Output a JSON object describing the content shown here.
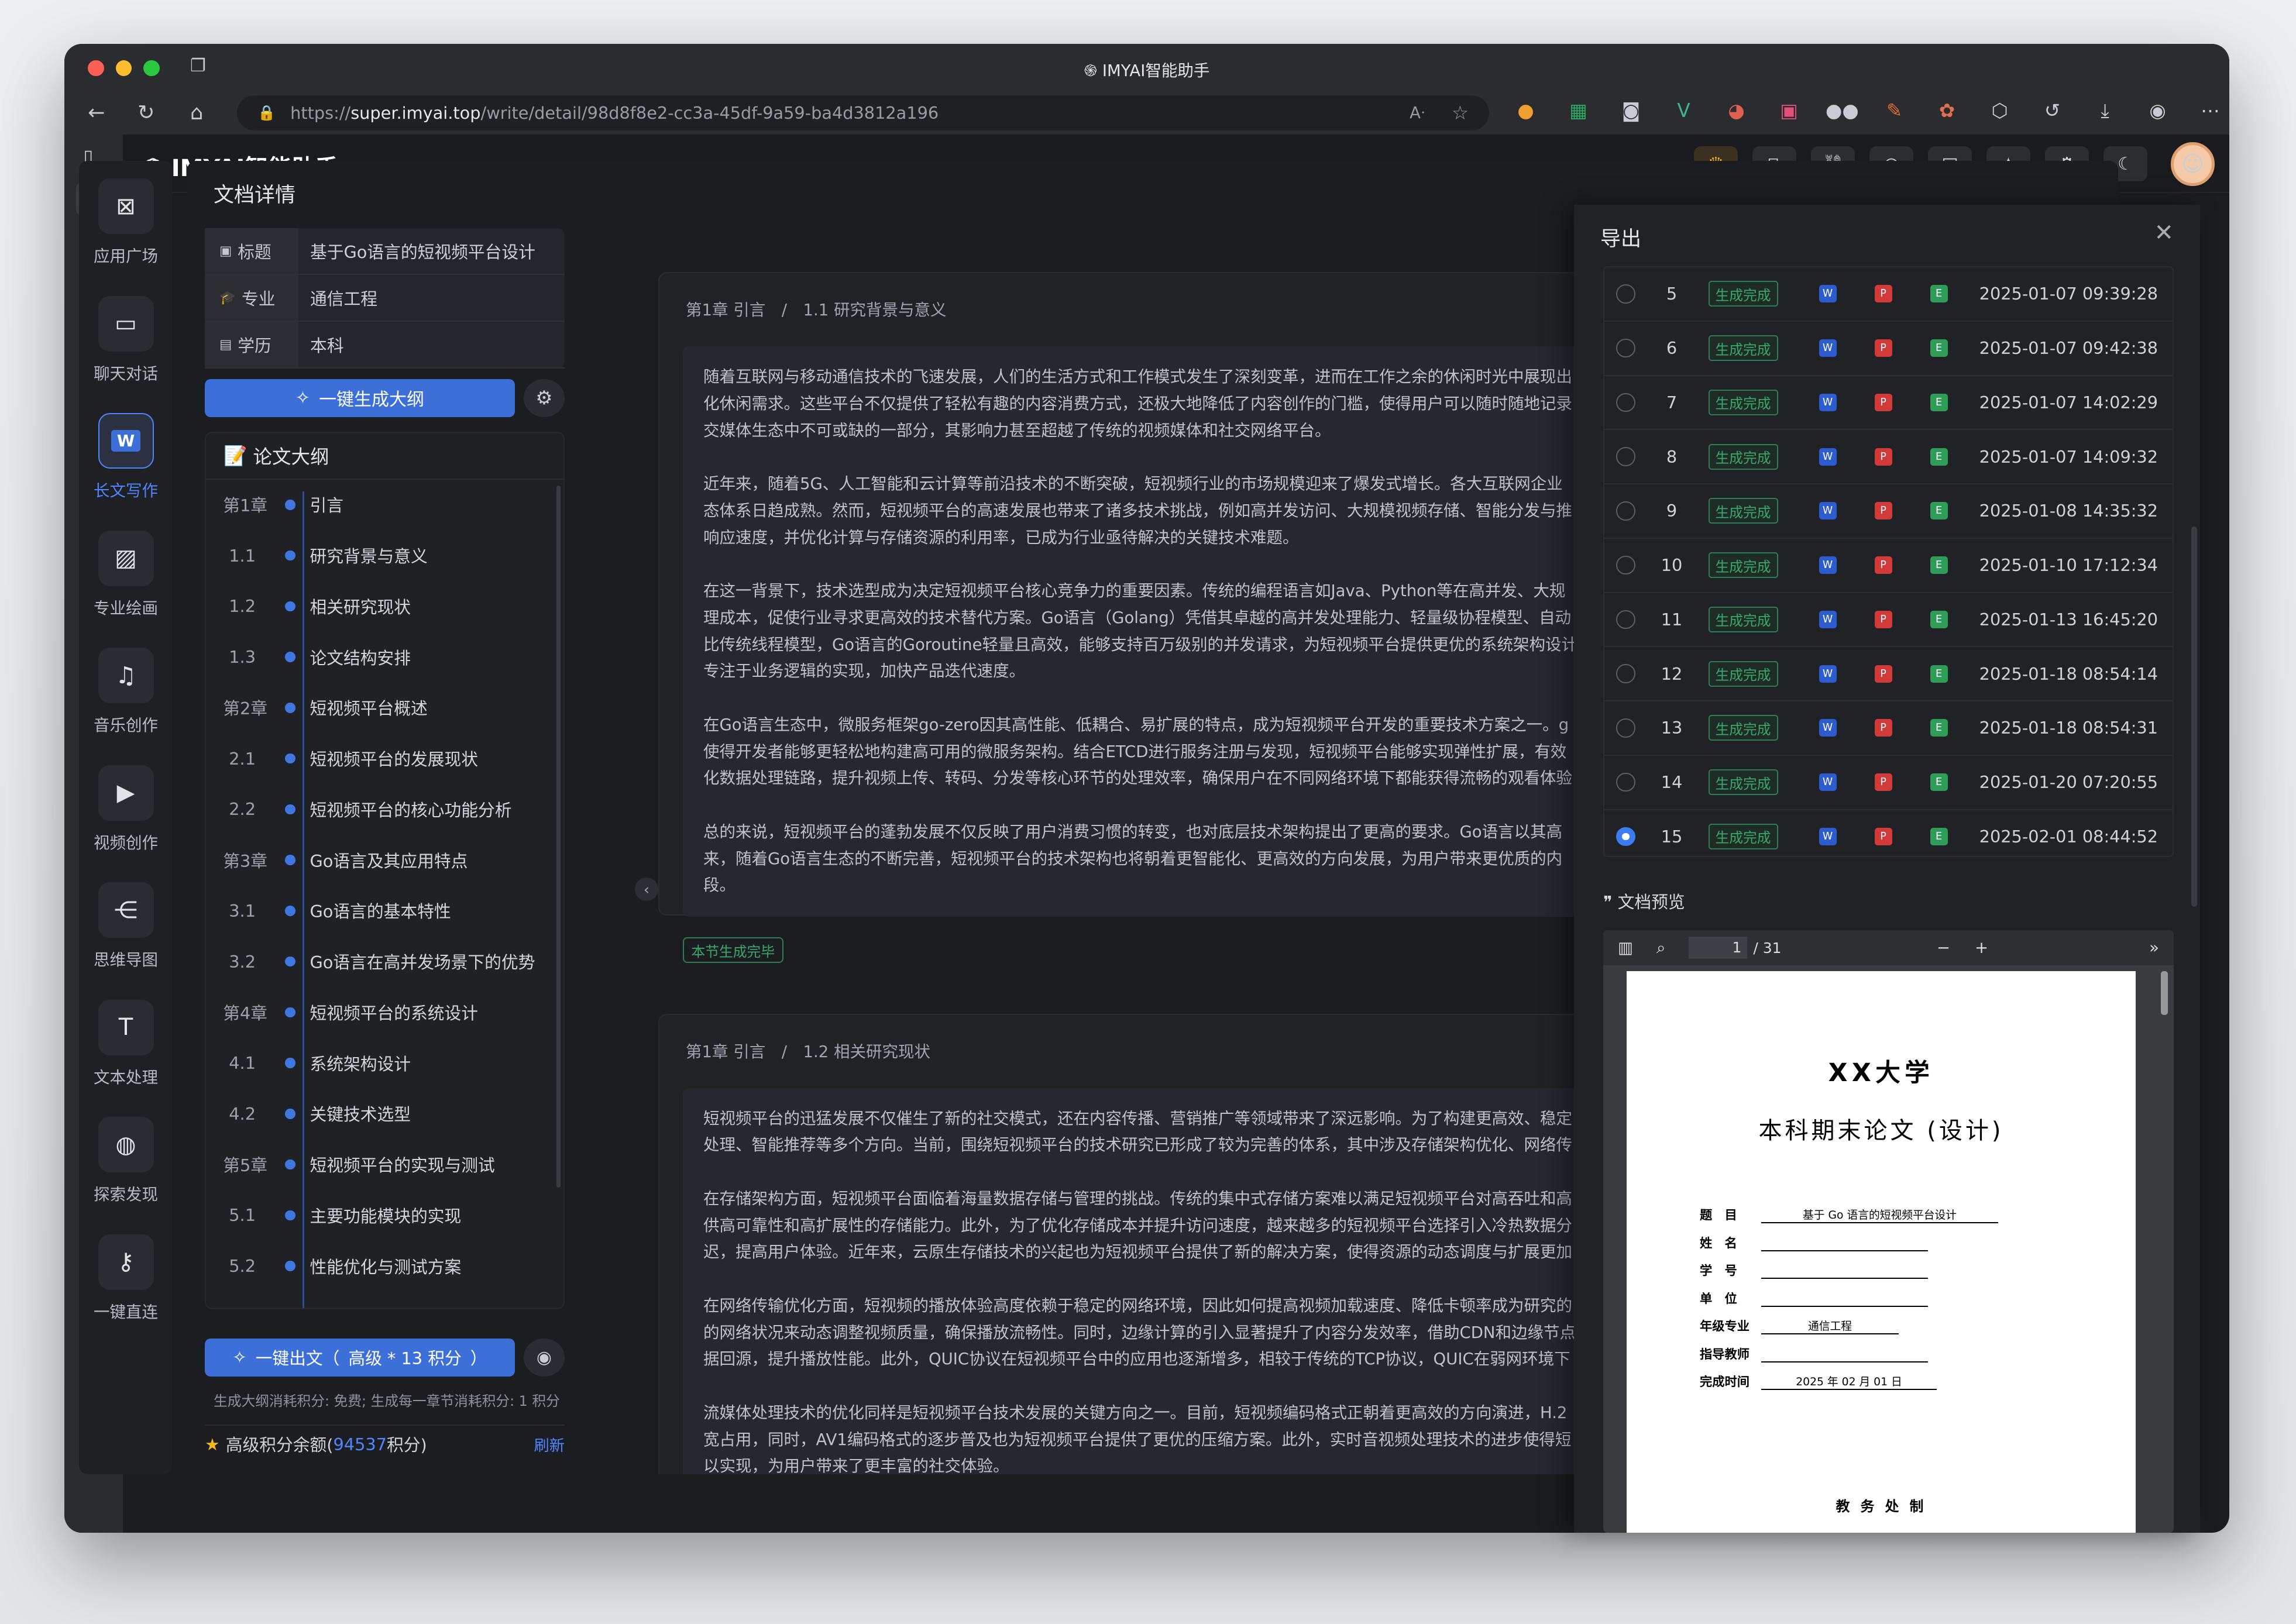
{
  "window": {
    "title": "IMYAI智能助手"
  },
  "browser": {
    "url_prefix": "https://",
    "url_host": "super.imyai.top",
    "url_path": "/write/detail/98d8f8e2-cc3a-45df-9a59-ba4d3812a196"
  },
  "app": {
    "name": "IMYAI智能助手"
  },
  "nav": [
    {
      "label": "应用广场",
      "icon": "app-square-icon"
    },
    {
      "label": "聊天对话",
      "icon": "chat-icon"
    },
    {
      "label": "长文写作",
      "icon": "word-doc-icon"
    },
    {
      "label": "专业绘画",
      "icon": "image-icon"
    },
    {
      "label": "音乐创作",
      "icon": "music-icon"
    },
    {
      "label": "视频创作",
      "icon": "video-icon"
    },
    {
      "label": "思维导图",
      "icon": "mindmap-icon"
    },
    {
      "label": "文本处理",
      "icon": "text-icon"
    },
    {
      "label": "探索发现",
      "icon": "planet-icon"
    },
    {
      "label": "一键直连",
      "icon": "link-icon"
    }
  ],
  "doc": {
    "title": "文档详情",
    "info": [
      {
        "key": "标题",
        "value": "基于Go语言的短视频平台设计"
      },
      {
        "key": "专业",
        "value": "通信工程"
      },
      {
        "key": "学历",
        "value": "本科"
      }
    ],
    "gen_outline_label": "一键生成大纲",
    "outline_title": "论文大纲",
    "outline": [
      {
        "num": "第1章",
        "title": "引言"
      },
      {
        "num": "1.1",
        "title": "研究背景与意义"
      },
      {
        "num": "1.2",
        "title": "相关研究现状"
      },
      {
        "num": "1.3",
        "title": "论文结构安排"
      },
      {
        "num": "第2章",
        "title": "短视频平台概述"
      },
      {
        "num": "2.1",
        "title": "短视频平台的发展现状"
      },
      {
        "num": "2.2",
        "title": "短视频平台的核心功能分析"
      },
      {
        "num": "第3章",
        "title": "Go语言及其应用特点"
      },
      {
        "num": "3.1",
        "title": "Go语言的基本特性"
      },
      {
        "num": "3.2",
        "title": "Go语言在高并发场景下的优势"
      },
      {
        "num": "第4章",
        "title": "短视频平台的系统设计"
      },
      {
        "num": "4.1",
        "title": "系统架构设计"
      },
      {
        "num": "4.2",
        "title": "关键技术选型"
      },
      {
        "num": "第5章",
        "title": "短视频平台的实现与测试"
      },
      {
        "num": "5.1",
        "title": "主要功能模块的实现"
      },
      {
        "num": "5.2",
        "title": "性能优化与测试方案"
      }
    ],
    "gen_article_label": "一键出文（",
    "gen_article_level": "高级 * 13 积分",
    "gen_article_close": "）",
    "cost_note": "生成大纲消耗积分: 免费; 生成每一章节消耗积分: 1 积分",
    "credit_label": "高级积分余额(",
    "credit_value": "94537",
    "credit_unit": "积分)",
    "refresh": "刷新"
  },
  "sections": [
    {
      "chapter": "第1章 引言",
      "sep": "/",
      "section": "1.1 研究背景与意义",
      "paragraphs": [
        [
          "随着互联网与移动通信技术的飞速发展，人们的生活方式和工作模式发生了深刻变革，进而在工作之余的休闲时光中展现出",
          "化休闲需求。这些平台不仅提供了轻松有趣的内容消费方式，还极大地降低了内容创作的门槛，使得用户可以随时随地记录",
          "交媒体生态中不可或缺的一部分，其影响力甚至超越了传统的视频媒体和社交网络平台。"
        ],
        [
          "近年来，随着5G、人工智能和云计算等前沿技术的不断突破，短视频行业的市场规模迎来了爆发式增长。各大互联网企业",
          "态体系日趋成熟。然而，短视频平台的高速发展也带来了诸多技术挑战，例如高并发访问、大规模视频存储、智能分发与推",
          "响应速度，并优化计算与存储资源的利用率，已成为行业亟待解决的关键技术难题。"
        ],
        [
          "在这一背景下，技术选型成为决定短视频平台核心竞争力的重要因素。传统的编程语言如Java、Python等在高并发、大规",
          "理成本，促使行业寻求更高效的技术替代方案。Go语言（Golang）凭借其卓越的高并发处理能力、轻量级协程模型、自动",
          "比传统线程模型，Go语言的Goroutine轻量且高效，能够支持百万级别的并发请求，为短视频平台提供更优的系统架构设计",
          "专注于业务逻辑的实现，加快产品迭代速度。"
        ],
        [
          "在Go语言生态中，微服务框架go-zero因其高性能、低耦合、易扩展的特点，成为短视频平台开发的重要技术方案之一。g",
          "使得开发者能够更轻松地构建高可用的微服务架构。结合ETCD进行服务注册与发现，短视频平台能够实现弹性扩展，有效",
          "化数据处理链路，提升视频上传、转码、分发等核心环节的处理效率，确保用户在不同网络环境下都能获得流畅的观看体验"
        ],
        [
          "总的来说，短视频平台的蓬勃发展不仅反映了用户消费习惯的转变，也对底层技术架构提出了更高的要求。Go语言以其高",
          "来，随着Go语言生态的不断完善，短视频平台的技术架构也将朝着更智能化、更高效的方向发展，为用户带来更优质的内",
          "段。"
        ]
      ],
      "status": "本节生成完毕"
    },
    {
      "chapter": "第1章 引言",
      "sep": "/",
      "section": "1.2 相关研究现状",
      "paragraphs": [
        [
          "短视频平台的迅猛发展不仅催生了新的社交模式，还在内容传播、营销推广等领域带来了深远影响。为了构建更高效、稳定",
          "处理、智能推荐等多个方向。当前，围绕短视频平台的技术研究已形成了较为完善的体系，其中涉及存储架构优化、网络传"
        ],
        [
          "在存储架构方面，短视频平台面临着海量数据存储与管理的挑战。传统的集中式存储方案难以满足短视频平台对高吞吐和高",
          "供高可靠性和高扩展性的存储能力。此外，为了优化存储成本并提升访问速度，越来越多的短视频平台选择引入冷热数据分",
          "迟，提高用户体验。近年来，云原生存储技术的兴起也为短视频平台提供了新的解决方案，使得资源的动态调度与扩展更加"
        ],
        [
          "在网络传输优化方面，短视频的播放体验高度依赖于稳定的网络环境，因此如何提高视频加载速度、降低卡顿率成为研究的",
          "的网络状况来动态调整视频质量，确保播放流畅性。同时，边缘计算的引入显著提升了内容分发效率，借助CDN和边缘节点",
          "据回源，提升播放性能。此外，QUIC协议在短视频平台中的应用也逐渐增多，相较于传统的TCP协议，QUIC在弱网环境下"
        ],
        [
          "流媒体处理技术的优化同样是短视频平台技术发展的关键方向之一。目前，短视频编码格式正朝着更高效的方向演进，H.2",
          "宽占用，同时，AV1编码格式的逐步普及也为短视频平台提供了更优的压缩方案。此外，实时音视频处理技术的进步使得短",
          "以实现，为用户带来了更丰富的社交体验。"
        ]
      ]
    }
  ],
  "export": {
    "title": "导出",
    "rows": [
      {
        "no": "5",
        "status": "生成完成",
        "time": "2025-01-07 09:39:28",
        "selected": false
      },
      {
        "no": "6",
        "status": "生成完成",
        "time": "2025-01-07 09:42:38",
        "selected": false
      },
      {
        "no": "7",
        "status": "生成完成",
        "time": "2025-01-07 14:02:29",
        "selected": false
      },
      {
        "no": "8",
        "status": "生成完成",
        "time": "2025-01-07 14:09:32",
        "selected": false
      },
      {
        "no": "9",
        "status": "生成完成",
        "time": "2025-01-08 14:35:32",
        "selected": false
      },
      {
        "no": "10",
        "status": "生成完成",
        "time": "2025-01-10 17:12:34",
        "selected": false
      },
      {
        "no": "11",
        "status": "生成完成",
        "time": "2025-01-13 16:45:20",
        "selected": false
      },
      {
        "no": "12",
        "status": "生成完成",
        "time": "2025-01-18 08:54:14",
        "selected": false
      },
      {
        "no": "13",
        "status": "生成完成",
        "time": "2025-01-18 08:54:31",
        "selected": false
      },
      {
        "no": "14",
        "status": "生成完成",
        "time": "2025-01-20 07:20:55",
        "selected": false
      },
      {
        "no": "15",
        "status": "生成完成",
        "time": "2025-02-01 08:44:52",
        "selected": true
      }
    ],
    "preview_title": "文档预览",
    "pdf": {
      "page": "1",
      "total": "/ 31",
      "university": "XX大学",
      "doc_type": "本科期末论文 (设计)",
      "fields": [
        {
          "label": "题　目",
          "value": "基于 Go 语言的短视频平台设计"
        },
        {
          "label": "姓　名",
          "value": ""
        },
        {
          "label": "学　号",
          "value": ""
        },
        {
          "label": "单　位",
          "value": ""
        },
        {
          "label": "年级专业",
          "value": "通信工程"
        },
        {
          "label": "指导教师",
          "value": ""
        },
        {
          "label": "完成时间",
          "value": "2025 年 02 月 01 日"
        }
      ],
      "footer": "教 务 处 制"
    }
  }
}
